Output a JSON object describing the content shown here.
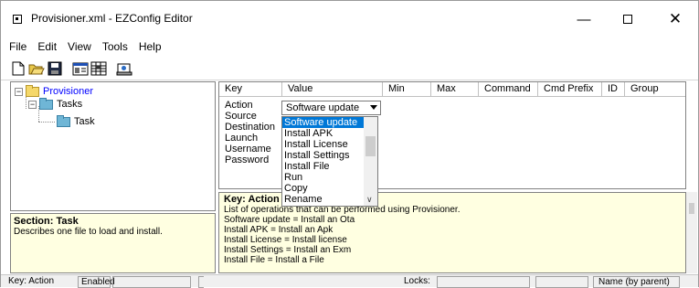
{
  "window": {
    "title": "Provisioner.xml - EZConfig Editor",
    "controls": {
      "minimize": "—",
      "close": "✕"
    }
  },
  "menu": [
    "File",
    "Edit",
    "View",
    "Tools",
    "Help"
  ],
  "toolbar": [
    "new-file-icon",
    "open-folder-icon",
    "save-disk-icon",
    "properties-icon",
    "grid-icon",
    "export-icon"
  ],
  "tree": {
    "root": {
      "label": "Provisioner",
      "toggle": "−"
    },
    "child": {
      "label": "Tasks",
      "toggle": "−"
    },
    "leaf": {
      "label": "Task"
    }
  },
  "section": {
    "title": "Section: Task",
    "description": "Describes one file to load and install."
  },
  "grid": {
    "columns": [
      "Key",
      "Value",
      "Min",
      "Max",
      "Command",
      "Cmd Prefix",
      "ID",
      "Group"
    ],
    "keys": [
      "Action",
      "Source",
      "Destination",
      "Launch",
      "Username",
      "Password"
    ]
  },
  "dropdown": {
    "selected": "Software update",
    "options": [
      "Software update",
      "Install APK",
      "Install License",
      "Install Settings",
      "Install File",
      "Run",
      "Copy",
      "Rename"
    ],
    "scroll_down": "∨"
  },
  "key_info": {
    "title": "Key: Action",
    "lines": [
      "List of operations that can be performed using Provisioner.",
      "Software update = Install an Ota",
      "Install APK = Install an Apk",
      "Install License = Install license",
      "Install Settings = Install an Exm",
      "Install File = Install a File"
    ]
  },
  "status": {
    "key": "Key: Action",
    "state": "Enabled",
    "locks": "Locks:",
    "name": "Name (by parent)"
  },
  "colors": {
    "help_background": "#ffffe1",
    "selection": "#0078d7",
    "tree_selected_text": "#0000ff"
  }
}
